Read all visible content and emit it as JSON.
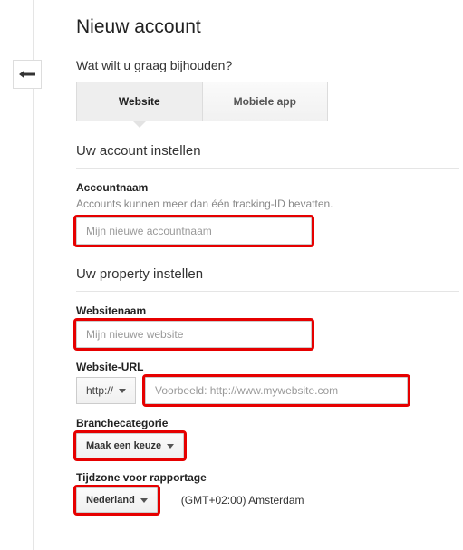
{
  "page_title": "Nieuw account",
  "tracking_question": "Wat wilt u graag bijhouden?",
  "tabs": {
    "website": "Website",
    "mobile": "Mobiele app"
  },
  "account": {
    "heading": "Uw account instellen",
    "label": "Accountnaam",
    "helper": "Accounts kunnen meer dan één tracking-ID bevatten.",
    "placeholder": "Mijn nieuwe accountnaam"
  },
  "property": {
    "heading": "Uw property instellen",
    "website_name_label": "Websitenaam",
    "website_name_placeholder": "Mijn nieuwe website",
    "url_label": "Website-URL",
    "protocol": "http://",
    "url_placeholder": "Voorbeeld: http://www.mywebsite.com",
    "category_label": "Branchecategorie",
    "category_value": "Maak een keuze",
    "timezone_label": "Tijdzone voor rapportage",
    "timezone_country": "Nederland",
    "timezone_value": "(GMT+02:00) Amsterdam"
  }
}
